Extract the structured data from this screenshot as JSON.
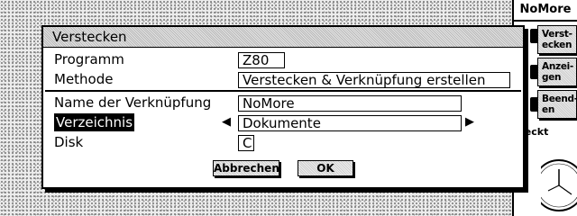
{
  "dialog": {
    "title": "Verstecken",
    "program": {
      "label": "Programm",
      "value": "Z80"
    },
    "method": {
      "label": "Methode",
      "value": "Verstecken & Verknüpfung erstellen"
    },
    "link_name": {
      "label": "Name der Verknüpfung",
      "value": "NoMore"
    },
    "directory": {
      "label": "Verzeichnis",
      "value": "Dokumente"
    },
    "disk": {
      "label": "Disk",
      "value": "C"
    },
    "cancel_label": "Abbrechen",
    "ok_label": "OK"
  },
  "toolbar": {
    "app_name": "NoMore",
    "buttons": [
      {
        "label": "Verst-\necken"
      },
      {
        "label": "Anzei-\ngen"
      },
      {
        "label": "Beend-\nen"
      }
    ],
    "status": "steckt"
  },
  "colors": {
    "background": "#ececec",
    "ink": "#000000",
    "panel": "#ffffff"
  }
}
